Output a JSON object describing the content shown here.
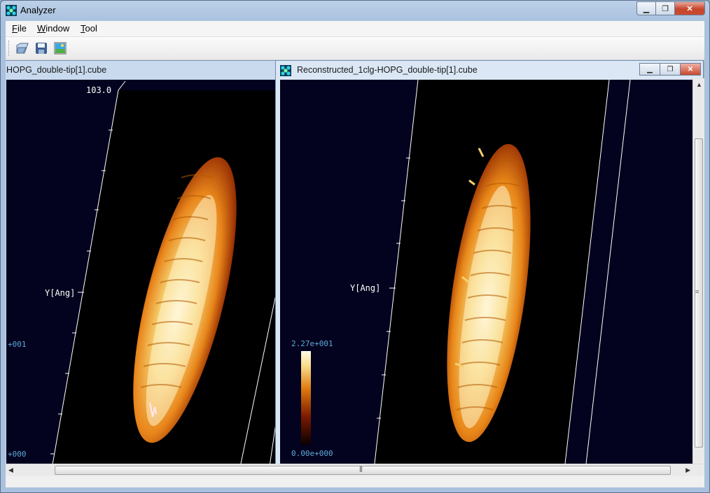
{
  "app": {
    "title": "Analyzer",
    "icon": "app-logo-icon"
  },
  "window_controls": {
    "minimize": "minimize-icon",
    "maximize": "maximize-icon",
    "close": "close-icon"
  },
  "menu": {
    "items": [
      {
        "label": "File",
        "accel": "F",
        "rest": "ile"
      },
      {
        "label": "Window",
        "accel": "W",
        "rest": "indow"
      },
      {
        "label": "Tool",
        "accel": "T",
        "rest": "ool"
      }
    ]
  },
  "toolbar": {
    "buttons": [
      {
        "icon": "open-file-icon"
      },
      {
        "icon": "save-icon"
      },
      {
        "icon": "image-icon"
      }
    ]
  },
  "left_window": {
    "title": "HOPG_double-tip[1].cube",
    "axis_top_value": "103.0",
    "y_axis_label": "Y[Ang]",
    "tick_label_a": "+001",
    "tick_label_b": "+000"
  },
  "right_window": {
    "title": "Reconstructed_1clg-HOPG_double-tip[1].cube",
    "y_axis_label": "Y[Ang]",
    "colorbar_max": "2.27e+001",
    "colorbar_min": "0.00e+000"
  },
  "colors": {
    "plot_background": "#03031f",
    "axis_label": "#5fa8d8",
    "surface_high": "#fff6d0",
    "surface_mid": "#f0a030",
    "surface_low": "#6a1a00"
  }
}
